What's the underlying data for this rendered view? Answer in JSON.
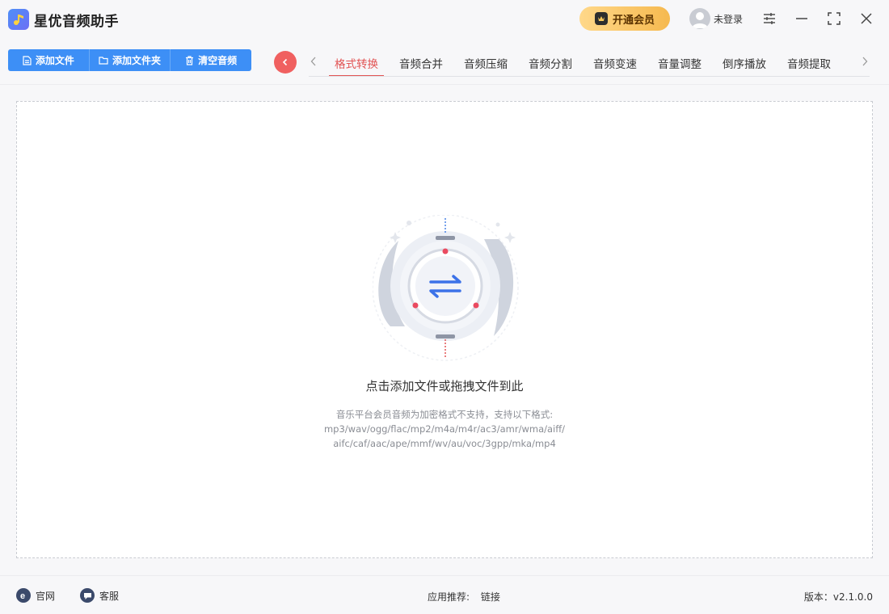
{
  "app": {
    "title": "星优音频助手"
  },
  "titlebar": {
    "vip_label": "开通会员",
    "login_label": "未登录",
    "controls": [
      "settings-icon",
      "minimize-icon",
      "maximize-icon",
      "close-icon"
    ]
  },
  "toolbar": {
    "add_file_label": "添加文件",
    "add_folder_label": "添加文件夹",
    "clear_label": "清空音频"
  },
  "tabs": [
    {
      "label": "格式转换",
      "active": true
    },
    {
      "label": "音频合并",
      "active": false
    },
    {
      "label": "音频压缩",
      "active": false
    },
    {
      "label": "音频分割",
      "active": false
    },
    {
      "label": "音频变速",
      "active": false
    },
    {
      "label": "音量调整",
      "active": false
    },
    {
      "label": "倒序播放",
      "active": false
    },
    {
      "label": "音频提取",
      "active": false
    }
  ],
  "dropzone": {
    "title": "点击添加文件或拖拽文件到此",
    "hint_line1": "音乐平台会员音频为加密格式不支持，支持以下格式:",
    "hint_line2": "mp3/wav/ogg/flac/mp2/m4a/m4r/ac3/amr/wma/aiff/",
    "hint_line3": "aifc/caf/aac/ape/mmf/wv/au/voc/3gpp/mka/mp4"
  },
  "footer": {
    "website_label": "官网",
    "service_label": "客服",
    "recommend_label": "应用推荐:",
    "link_label": "链接",
    "version_label": "版本：v2.1.0.0"
  },
  "colors": {
    "accent_blue": "#3d8ff6",
    "active_tab_red": "#e25454",
    "vip_gold": "#f6b94f",
    "back_button_red": "#f06060"
  }
}
